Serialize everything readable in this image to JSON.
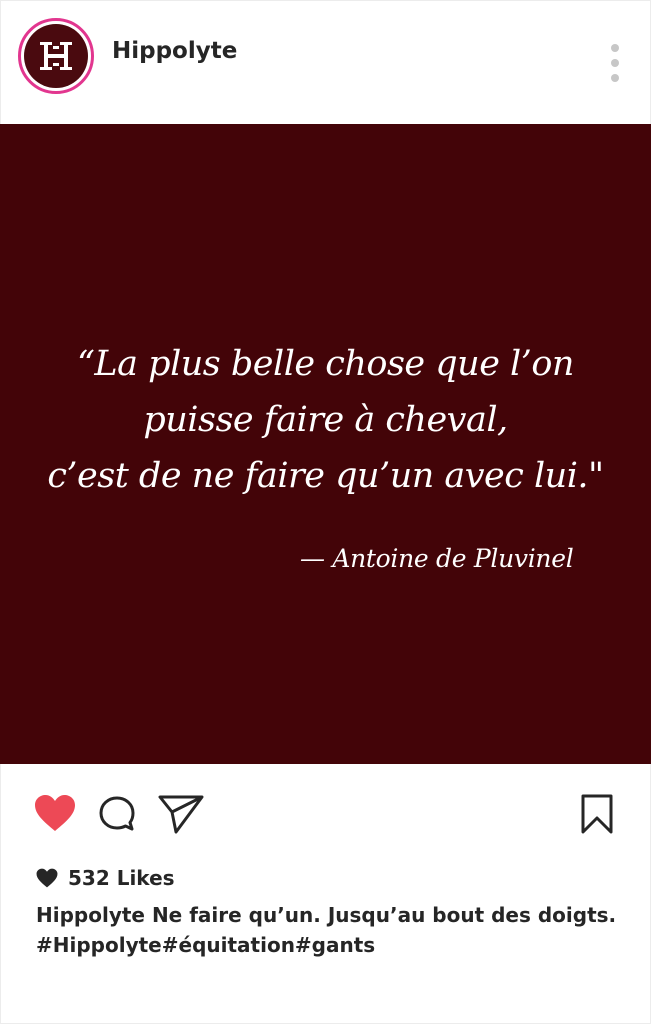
{
  "header": {
    "username": "Hippolyte",
    "avatar_letter": "H"
  },
  "post": {
    "quote_lines": [
      "“La plus belle chose que l’on",
      "puisse faire à cheval,",
      "c’est de ne faire qu’un avec lui.\""
    ],
    "author": "— Antoine de Pluvinel",
    "background_color": "#430408"
  },
  "actions": {
    "like_icon": "heart-icon",
    "comment_icon": "comment-icon",
    "share_icon": "send-icon",
    "save_icon": "bookmark-icon",
    "like_color": "#ed4956"
  },
  "likes": {
    "text": "532 Likes"
  },
  "caption": {
    "line1": "Hippolyte Ne faire qu’un. Jusqu’au bout des doigts.",
    "line2": "#Hippolyte#équitation#gants"
  }
}
